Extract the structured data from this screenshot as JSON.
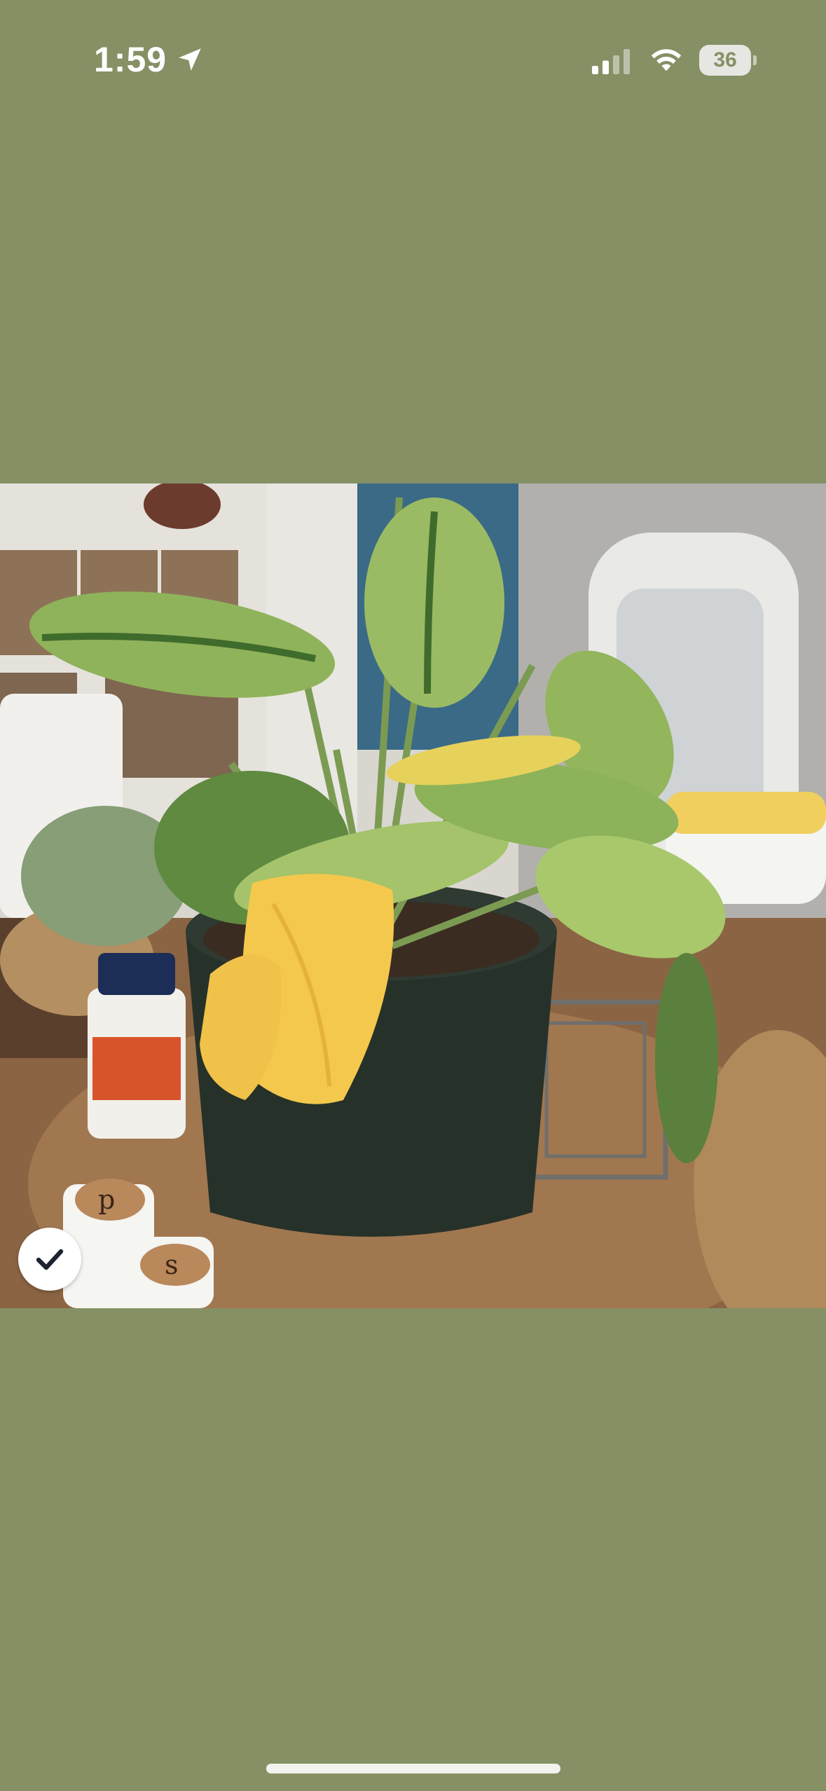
{
  "status_bar": {
    "time": "1:59",
    "battery_level": "36",
    "location_icon": "location-arrow-icon",
    "signal_icon": "cellular-signal-icon",
    "wifi_icon": "wifi-icon"
  },
  "photo": {
    "selected": true,
    "selection_icon": "checkmark-icon"
  },
  "colors": {
    "background": "#869065",
    "status_text": "#ffffff"
  }
}
